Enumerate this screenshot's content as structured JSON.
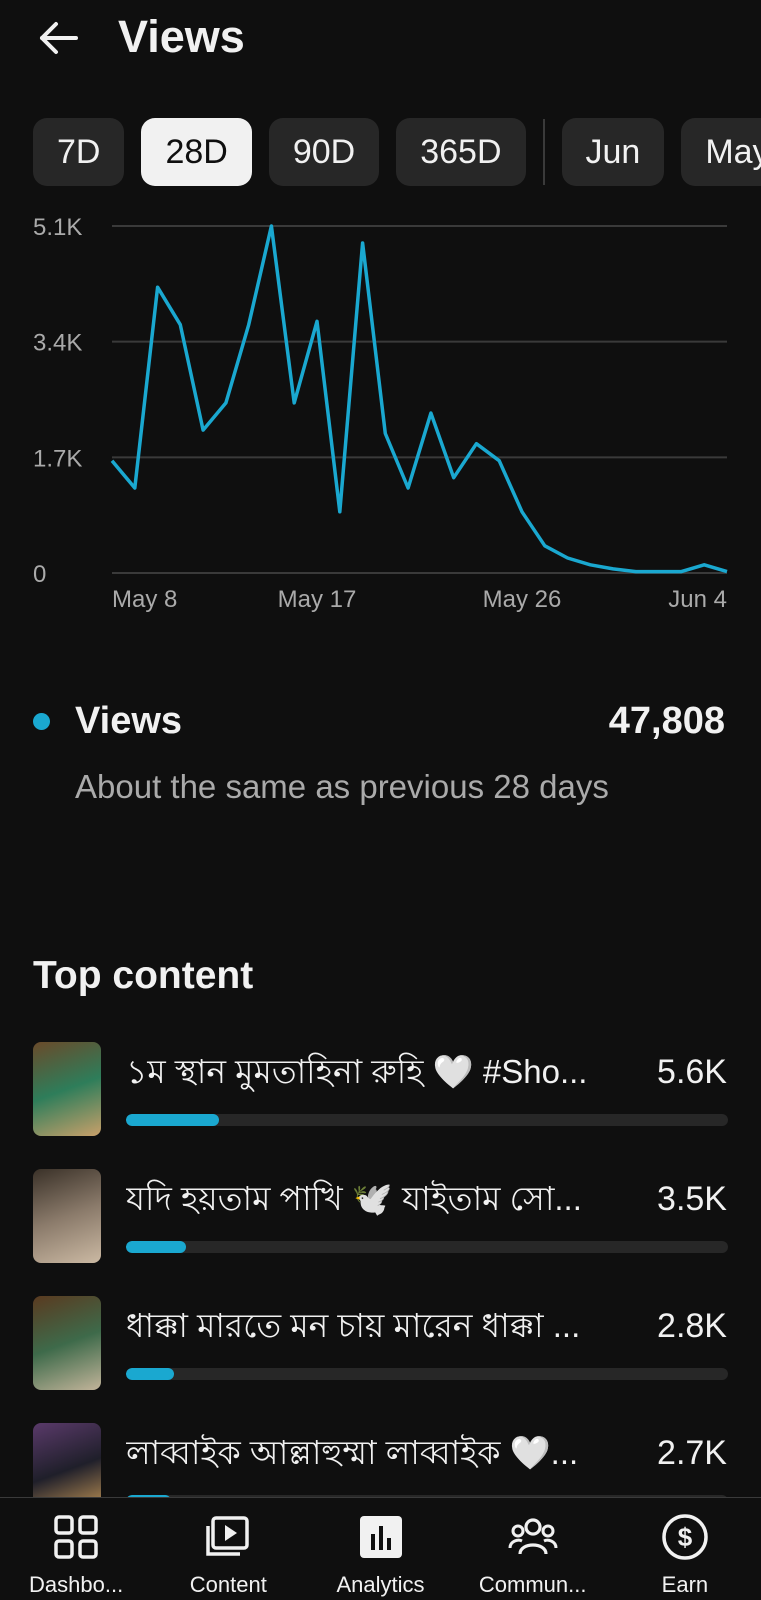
{
  "header": {
    "title": "Views",
    "back_icon": "arrow-left-icon"
  },
  "chips": [
    {
      "label": "7D",
      "active": false
    },
    {
      "label": "28D",
      "active": true
    },
    {
      "label": "90D",
      "active": false
    },
    {
      "label": "365D",
      "active": false
    },
    {
      "label": "Jun",
      "active": false
    },
    {
      "label": "May",
      "active": false
    }
  ],
  "chart_data": {
    "type": "line",
    "x": [
      "May 8",
      "May 9",
      "May 10",
      "May 11",
      "May 12",
      "May 13",
      "May 14",
      "May 15",
      "May 16",
      "May 17",
      "May 18",
      "May 19",
      "May 20",
      "May 21",
      "May 22",
      "May 23",
      "May 24",
      "May 25",
      "May 26",
      "May 27",
      "May 28",
      "May 29",
      "May 30",
      "May 31",
      "Jun 1",
      "Jun 2",
      "Jun 3",
      "Jun 4"
    ],
    "series": [
      {
        "values": [
          1650,
          1250,
          4200,
          3650,
          2100,
          2500,
          3650,
          5100,
          2500,
          3700,
          900,
          4850,
          2050,
          1250,
          2350,
          1400,
          1900,
          1650,
          900,
          400,
          220,
          120,
          60,
          20,
          20,
          20,
          120,
          20
        ],
        "color": "#1aa8d0"
      }
    ],
    "y_ticks": [
      "0",
      "1.7K",
      "3.4K",
      "5.1K"
    ],
    "x_ticks": [
      "May 8",
      "May 17",
      "May 26",
      "Jun 4"
    ],
    "ylim": [
      0,
      5100
    ],
    "grid": true,
    "colors": {
      "line": "#1aa8d0",
      "grid": "#3a3a3a",
      "tick": "#aaaaaa"
    }
  },
  "metric": {
    "label": "Views",
    "value": "47,808",
    "note": "About the same as previous 28 days",
    "color": "#1aa8d0"
  },
  "top_content": {
    "title": "Top content",
    "items": [
      {
        "title": "১ম স্থান মুমতাহিনা রুহি 🤍 #Sho...",
        "count": "5.6K",
        "fraction": 0.155,
        "thumb_colors": [
          "#6a4a2a",
          "#2e7d5a",
          "#c9a06a"
        ]
      },
      {
        "title": "যদি হয়তাম পাখি 🕊️ যাইতাম সো...",
        "count": "3.5K",
        "fraction": 0.1,
        "thumb_colors": [
          "#3a3128",
          "#8a7a6a",
          "#cbb9a3"
        ]
      },
      {
        "title": "ধাক্কা মারতে মন চায় মারেন ধাক্কা ...",
        "count": "2.8K",
        "fraction": 0.08,
        "thumb_colors": [
          "#5a3a20",
          "#3e6a4a",
          "#c2b49a"
        ]
      },
      {
        "title": "লাব্বাইক আল্লাহুম্মা লাব্বাইক 🤍...",
        "count": "2.7K",
        "fraction": 0.075,
        "thumb_colors": [
          "#5a3a6a",
          "#1f1f2a",
          "#d2a15a"
        ]
      }
    ]
  },
  "bottom_nav": [
    {
      "label": "Dashbo...",
      "icon": "dashboard-grid-icon"
    },
    {
      "label": "Content",
      "icon": "content-library-icon"
    },
    {
      "label": "Analytics",
      "icon": "analytics-bar-icon"
    },
    {
      "label": "Commun...",
      "icon": "community-people-icon"
    },
    {
      "label": "Earn",
      "icon": "earn-dollar-icon"
    }
  ]
}
